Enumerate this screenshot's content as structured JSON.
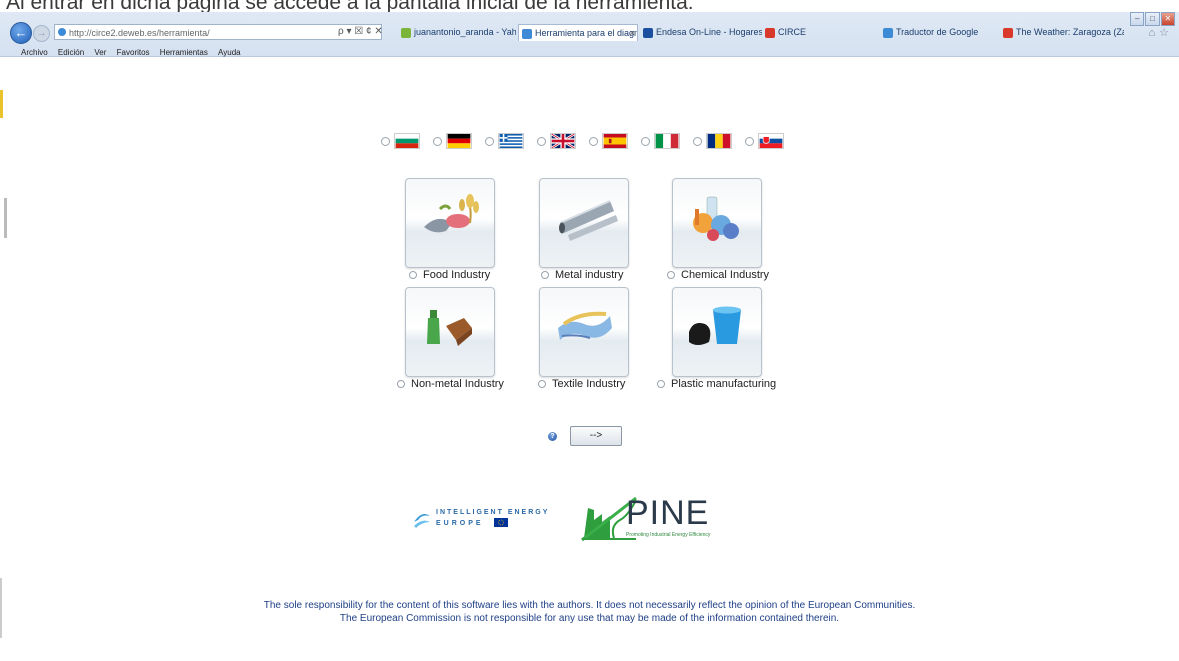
{
  "caption": "Al entrar en dicha página se accede a la pantalla inicial de la herramienta:",
  "browser": {
    "address": "http://circe2.deweb.es/herramienta/",
    "address_controls": "ρ ▾ ☒ ¢ ✕",
    "tabs": [
      {
        "label": "juanantonio_aranda - Yahoo! ...",
        "color": "#7bb63a"
      },
      {
        "label": "Herramienta para el diagnó...",
        "color": "#3d8ad6",
        "active": true
      },
      {
        "label": "Endesa On-Line - Hogares",
        "color": "#1b4fa0"
      },
      {
        "label": "CIRCE",
        "color": "#d9392b"
      },
      {
        "label": "Traductor de Google",
        "color": "#3d8ad6"
      },
      {
        "label": "The Weather: Zaragoza (Zarag...",
        "color": "#d9392b"
      }
    ],
    "menu": [
      "Archivo",
      "Edición",
      "Ver",
      "Favoritos",
      "Herramientas",
      "Ayuda"
    ]
  },
  "languages": [
    {
      "code": "bg",
      "icon": "bulgaria-flag-icon"
    },
    {
      "code": "de",
      "icon": "germany-flag-icon"
    },
    {
      "code": "el",
      "icon": "greece-flag-icon"
    },
    {
      "code": "en",
      "icon": "uk-flag-icon"
    },
    {
      "code": "es",
      "icon": "spain-flag-icon"
    },
    {
      "code": "it",
      "icon": "italy-flag-icon"
    },
    {
      "code": "ro",
      "icon": "romania-flag-icon"
    },
    {
      "code": "sk",
      "icon": "slovakia-flag-icon"
    }
  ],
  "industries": [
    {
      "label": "Food Industry",
      "icon": "food-icon"
    },
    {
      "label": "Metal industry",
      "icon": "metal-pipe-icon"
    },
    {
      "label": "Chemical Industry",
      "icon": "chemistry-flask-icon"
    },
    {
      "label": "Non-metal Industry",
      "icon": "bottle-brick-icon"
    },
    {
      "label": "Textile Industry",
      "icon": "fabric-icon"
    },
    {
      "label": "Plastic manufacturing",
      "icon": "plastic-bucket-icon"
    }
  ],
  "next_button": "-->",
  "logos": {
    "iee_line1": "INTELLIGENT ENERGY",
    "iee_line2": "EUROPE",
    "pine": "PINE",
    "pine_tagline": "Promoting Industrial Energy Efficiency"
  },
  "footer": {
    "line1": "The sole responsibility for the content of this software lies with the authors. It does not necessarily reflect the opinion of the European Communities.",
    "line2": "The European Commission is not responsible for any use that may be made of the information contained therein."
  }
}
